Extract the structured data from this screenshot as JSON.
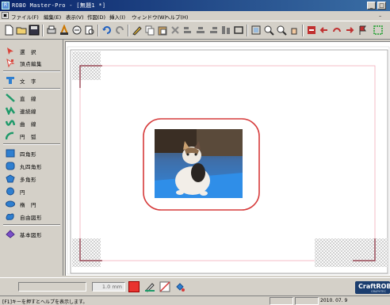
{
  "window": {
    "title": "ROBO Master-Pro - [無題1 *]",
    "buttons": [
      "minimize",
      "maximize"
    ]
  },
  "menu": {
    "items": [
      "ファイル(F)",
      "編集(E)",
      "表示(V)",
      "作図(D)",
      "挿入(I)",
      "ウィンドウ(W)",
      "ヘルプ(H)"
    ]
  },
  "toolbar": {
    "icons": [
      "new-file-icon",
      "open-file-icon",
      "save-icon",
      "print-icon",
      "print-setup-icon",
      "cut-plot-icon",
      "preview-icon",
      "undo-icon",
      "redo-icon",
      "pen-icon",
      "copy-icon",
      "paste-icon",
      "delete-icon",
      "align-left-icon",
      "align-center-icon",
      "align-right-icon",
      "distribute-icon",
      "frame-icon",
      "zoom-fit-icon",
      "zoom-in-icon",
      "zoom-out-icon",
      "hand-icon",
      "send-icon",
      "back-arrow-icon",
      "rotate-icon",
      "forward-arrow-icon",
      "flag-icon",
      "select-all-icon"
    ]
  },
  "tools": [
    {
      "label": "選　択",
      "icon": "select-arrow-icon",
      "color": "#d9443a"
    },
    {
      "label": "頂点編集",
      "icon": "node-edit-icon",
      "color": "#d9443a"
    },
    {
      "label": "文　字",
      "icon": "text-tool-icon",
      "color": "#2f7fd0"
    },
    {
      "label": "直　線",
      "icon": "line-tool-icon",
      "color": "#1f9a6a"
    },
    {
      "label": "連続線",
      "icon": "polyline-tool-icon",
      "color": "#1f9a6a"
    },
    {
      "label": "曲　線",
      "icon": "curve-tool-icon",
      "color": "#1f9a6a"
    },
    {
      "label": "円　弧",
      "icon": "arc-tool-icon",
      "color": "#1f9a6a"
    },
    {
      "label": "四角形",
      "icon": "rectangle-tool-icon",
      "color": "#2f7fd0"
    },
    {
      "label": "丸四角形",
      "icon": "rounded-rect-tool-icon",
      "color": "#2f7fd0"
    },
    {
      "label": "多角形",
      "icon": "polygon-tool-icon",
      "color": "#2f7fd0"
    },
    {
      "label": "円",
      "icon": "circle-tool-icon",
      "color": "#2f7fd0"
    },
    {
      "label": "楕　円",
      "icon": "ellipse-tool-icon",
      "color": "#2f7fd0"
    },
    {
      "label": "自由図形",
      "icon": "freeform-tool-icon",
      "color": "#2f7fd0"
    },
    {
      "label": "基本図形",
      "icon": "basic-shape-tool-icon",
      "color": "#7a4fc8"
    }
  ],
  "status": {
    "line_width": "1.0 mm",
    "fill_color": "#e8332f",
    "message": "[F1]キーを押すとヘルプを表示します。",
    "date": "2010. 07. 9"
  },
  "logo": {
    "text": "CraftROBO",
    "sub": "GRAPHTEC"
  },
  "canvas": {
    "frame_color": "#d63a3a",
    "mark_color": "#8b2a3a"
  }
}
